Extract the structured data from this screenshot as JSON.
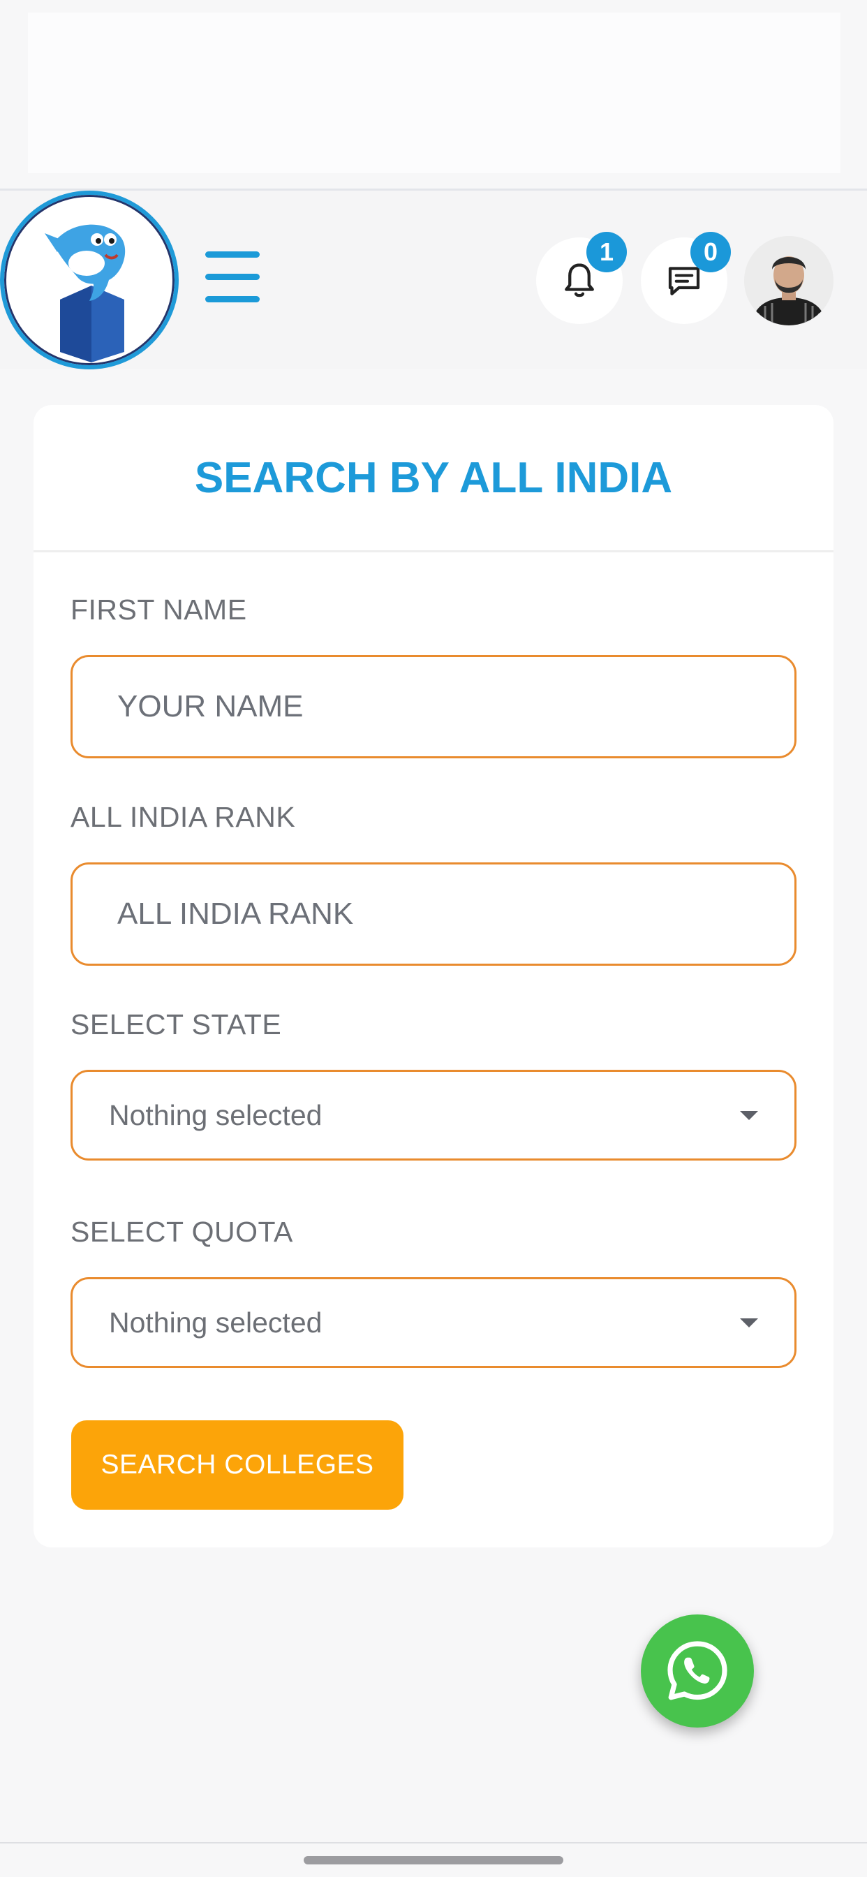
{
  "header": {
    "notification_count": "1",
    "message_count": "0",
    "icons": {
      "logo": "dolphin-logo",
      "menu": "hamburger-menu-icon",
      "notifications": "bell-icon",
      "messages": "chat-icon",
      "avatar": "user-avatar"
    }
  },
  "card": {
    "title": "SEARCH BY ALL INDIA",
    "fields": {
      "first_name": {
        "label": "FIRST NAME",
        "placeholder": "YOUR NAME"
      },
      "rank": {
        "label": "ALL INDIA RANK",
        "placeholder": "ALL INDIA RANK"
      },
      "state": {
        "label": "SELECT STATE",
        "selected": "Nothing selected"
      },
      "quota": {
        "label": "SELECT QUOTA",
        "selected": "Nothing selected"
      }
    },
    "submit_label": "SEARCH COLLEGES"
  },
  "fab": {
    "icon": "whatsapp-icon"
  },
  "colors": {
    "accent_blue": "#1d9ad9",
    "input_border": "#e98b2e",
    "button": "#fca409",
    "whatsapp": "#48c34d"
  }
}
